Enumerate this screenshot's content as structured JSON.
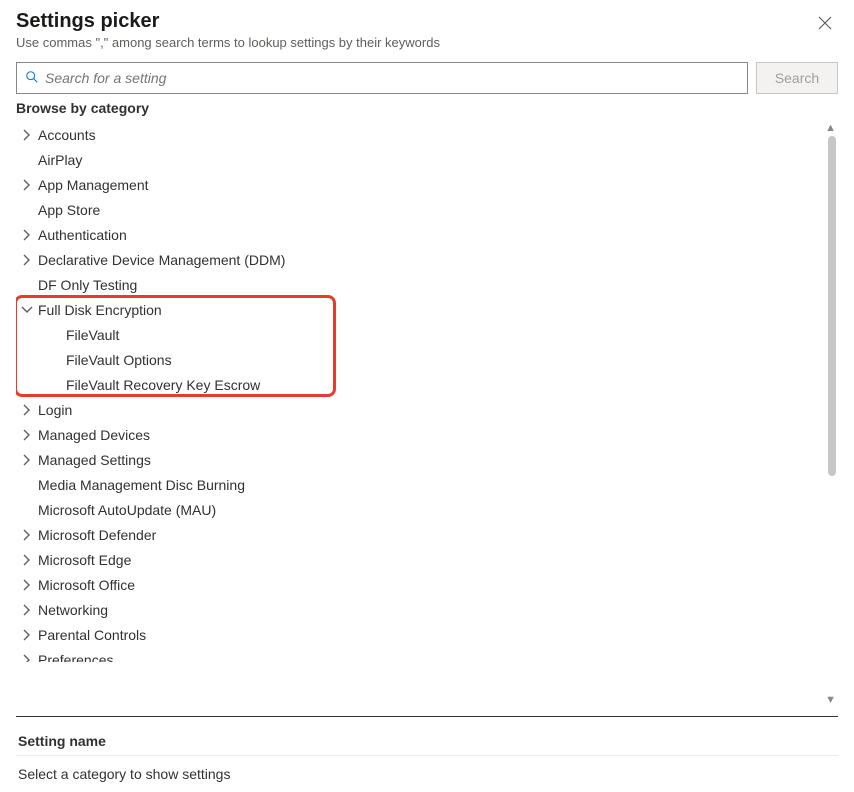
{
  "header": {
    "title": "Settings picker",
    "subtitle": "Use commas \",\" among search terms to lookup settings by their keywords"
  },
  "search": {
    "placeholder": "Search for a setting",
    "button_label": "Search"
  },
  "browse_label": "Browse by category",
  "categories": [
    {
      "label": "Accounts",
      "expandable": true,
      "expanded": false
    },
    {
      "label": "AirPlay",
      "expandable": false
    },
    {
      "label": "App Management",
      "expandable": true,
      "expanded": false
    },
    {
      "label": "App Store",
      "expandable": false
    },
    {
      "label": "Authentication",
      "expandable": true,
      "expanded": false
    },
    {
      "label": "Declarative Device Management (DDM)",
      "expandable": true,
      "expanded": false
    },
    {
      "label": "DF Only Testing",
      "expandable": false
    },
    {
      "label": "Full Disk Encryption",
      "expandable": true,
      "expanded": true,
      "highlighted": true,
      "children": [
        {
          "label": "FileVault"
        },
        {
          "label": "FileVault Options"
        },
        {
          "label": "FileVault Recovery Key Escrow"
        }
      ]
    },
    {
      "label": "Login",
      "expandable": true,
      "expanded": false
    },
    {
      "label": "Managed Devices",
      "expandable": true,
      "expanded": false
    },
    {
      "label": "Managed Settings",
      "expandable": true,
      "expanded": false
    },
    {
      "label": "Media Management Disc Burning",
      "expandable": false
    },
    {
      "label": "Microsoft AutoUpdate (MAU)",
      "expandable": false
    },
    {
      "label": "Microsoft Defender",
      "expandable": true,
      "expanded": false
    },
    {
      "label": "Microsoft Edge",
      "expandable": true,
      "expanded": false
    },
    {
      "label": "Microsoft Office",
      "expandable": true,
      "expanded": false
    },
    {
      "label": "Networking",
      "expandable": true,
      "expanded": false
    },
    {
      "label": "Parental Controls",
      "expandable": true,
      "expanded": false
    },
    {
      "label": "Preferences",
      "expandable": true,
      "expanded": false
    }
  ],
  "settings_table": {
    "header": "Setting name",
    "empty_text": "Select a category to show settings"
  }
}
